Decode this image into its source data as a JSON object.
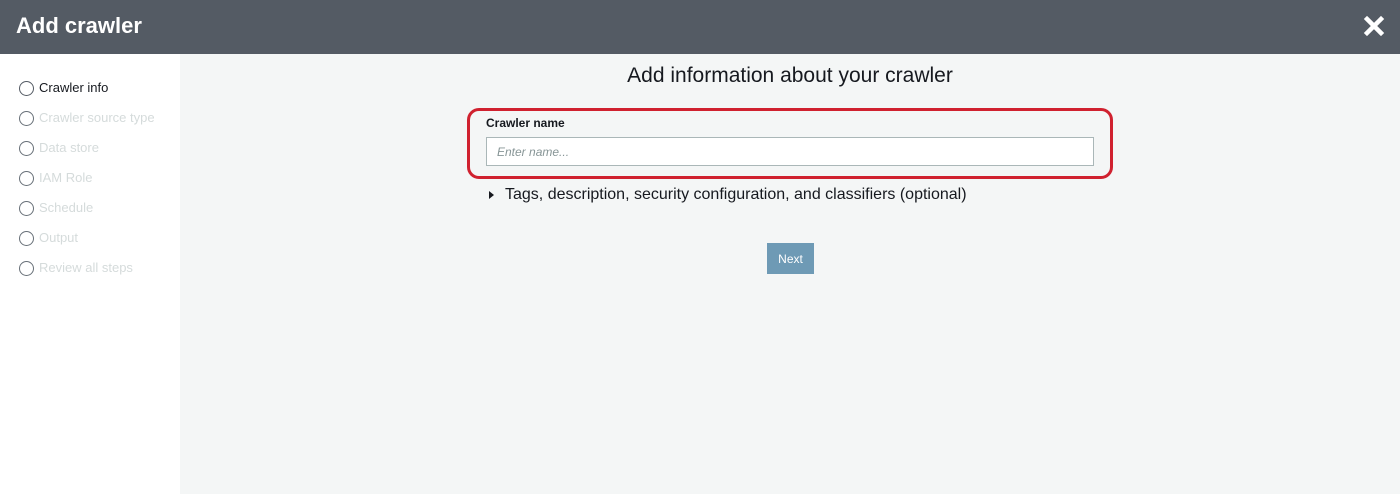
{
  "header": {
    "title": "Add crawler",
    "close_icon": "close-icon"
  },
  "sidebar": {
    "steps": [
      {
        "label": "Crawler info",
        "state": "active"
      },
      {
        "label": "Crawler source type",
        "state": "disabled"
      },
      {
        "label": "Data store",
        "state": "disabled"
      },
      {
        "label": "IAM Role",
        "state": "disabled"
      },
      {
        "label": "Schedule",
        "state": "disabled"
      },
      {
        "label": "Output",
        "state": "disabled"
      },
      {
        "label": "Review all steps",
        "state": "disabled"
      }
    ]
  },
  "main": {
    "title": "Add information about your crawler",
    "crawler_name": {
      "label": "Crawler name",
      "value": "",
      "placeholder": "Enter name..."
    },
    "optional_section": {
      "label": "Tags, description, security configuration, and classifiers (optional)",
      "expanded": false
    },
    "next_label": "Next"
  },
  "colors": {
    "header_bg": "#545b64",
    "highlight": "#d0212f",
    "next_button": "#6e9ab5",
    "content_bg": "#f4f6f6"
  }
}
